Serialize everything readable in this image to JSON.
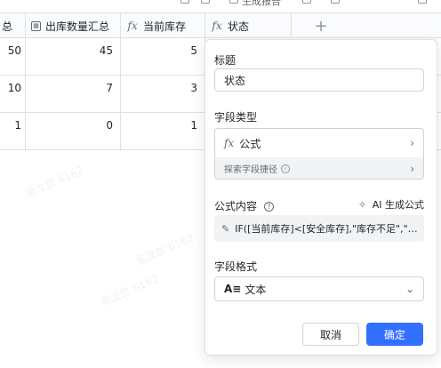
{
  "toolbar": {
    "visible_text": "生成报告"
  },
  "grid": {
    "headers": [
      {
        "label": "总",
        "icon": "none"
      },
      {
        "label": "出库数量汇总",
        "icon": "lookup-icon"
      },
      {
        "label": "当前库存",
        "icon": "formula-icon"
      },
      {
        "label": "状态",
        "icon": "formula-icon"
      }
    ],
    "add_column": "+",
    "rows": [
      [
        "50",
        "45",
        "5"
      ],
      [
        "10",
        "7",
        "3"
      ],
      [
        "1",
        "0",
        "1"
      ]
    ]
  },
  "watermark": "吴汶哲 6162",
  "panel": {
    "title_label": "标题",
    "title_value": "状态",
    "field_type_label": "字段类型",
    "field_type_value": "公式",
    "explore_label": "探索字段捷径",
    "formula_label": "公式内容",
    "ai_label": "AI 生成公式",
    "formula_value": "IF([当前库存]<[安全库存],\"库存不足\",\"…",
    "format_label": "字段格式",
    "format_value": "文本",
    "cancel_label": "取消",
    "confirm_label": "确定"
  },
  "colors": {
    "primary": "#3370ff",
    "border": "#dee0e3",
    "muted_bg": "#f2f3f5"
  }
}
